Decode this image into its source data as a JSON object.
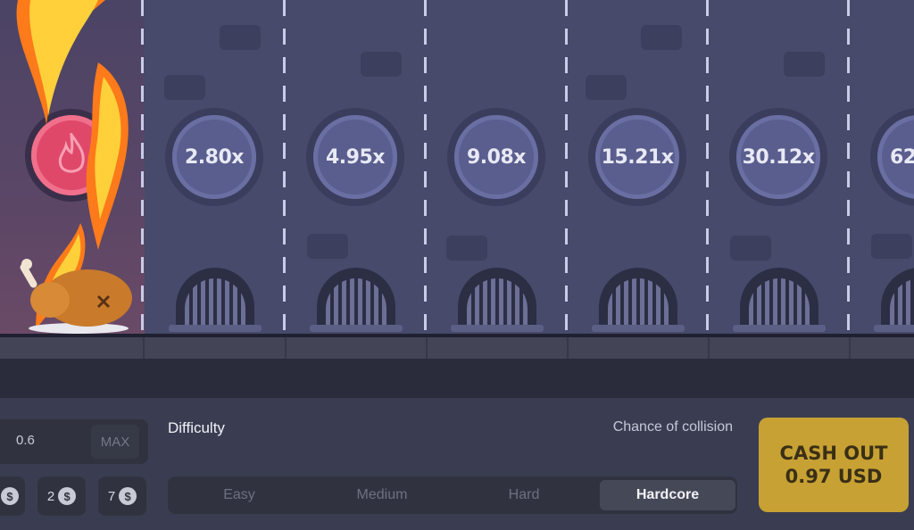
{
  "board": {
    "multipliers": [
      "2.80x",
      "4.95x",
      "9.08x",
      "15.21x",
      "30.12x",
      "62."
    ]
  },
  "bet": {
    "amount": "0.6",
    "max_label": "MAX",
    "presets": [
      {
        "value": "",
        "icon": "dollar-icon"
      },
      {
        "value": "2",
        "icon": "dollar-icon"
      },
      {
        "value": "7",
        "icon": "dollar-icon"
      }
    ],
    "currency_symbol": "$"
  },
  "difficulty": {
    "label": "Difficulty",
    "collision_label": "Chance of collision",
    "options": [
      "Easy",
      "Medium",
      "Hard",
      "Hardcore"
    ],
    "selected": "Hardcore"
  },
  "cashout": {
    "line1": "CASH OUT",
    "line2": "0.97 USD"
  },
  "colors": {
    "accent": "#c7a133",
    "board": "#474a6b",
    "fire": "#e0486a"
  }
}
